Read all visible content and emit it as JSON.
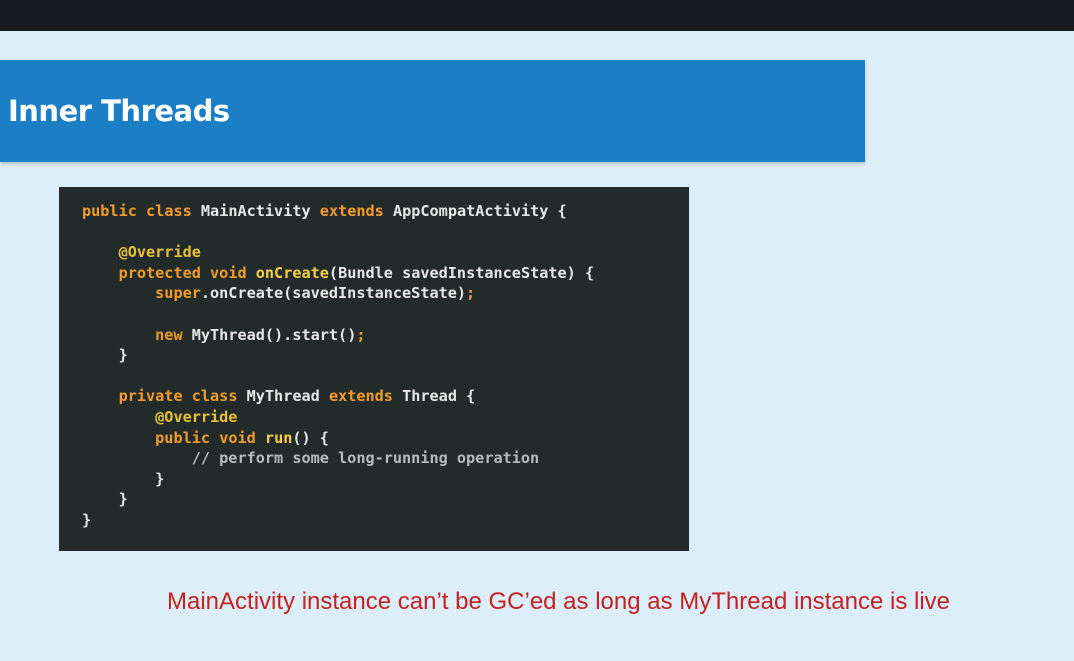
{
  "slide": {
    "title": "Inner Threads",
    "caption": "MainActivity instance can’t be GC’ed as long as MyThread instance is live"
  },
  "code": {
    "language": "java",
    "tokens": {
      "l1_kw1": "public",
      "l1_kw2": "class",
      "l1_name": "MainActivity",
      "l1_kw3": "extends",
      "l1_rest": "AppCompatActivity {",
      "l3_ann": "@Override",
      "l4_kw1": "protected",
      "l4_kw2": "void",
      "l4_fn": "onCreate",
      "l4_rest": "(Bundle savedInstanceState) {",
      "l5_kw": "super",
      "l5_rest": ".onCreate(savedInstanceState)",
      "l5_semi": ";",
      "l7_kw": "new",
      "l7_rest": "MyThread().start()",
      "l7_semi": ";",
      "l8_brace": "}",
      "l10_kw1": "private",
      "l10_kw2": "class",
      "l10_name": "MyThread",
      "l10_kw3": "extends",
      "l10_rest": "Thread {",
      "l11_ann": "@Override",
      "l12_kw1": "public",
      "l12_kw2": "void",
      "l12_fn": "run",
      "l12_rest": "() {",
      "l13_cm": "// perform some long-running operation",
      "l14_brace": "}",
      "l15_brace": "}",
      "l16_brace": "}"
    }
  },
  "colors": {
    "top_bar": "#151a21",
    "background": "#ddeefb",
    "banner": "#1c7ec4",
    "code_bg": "#222b2a",
    "keyword": "#f49c2b",
    "annotation": "#e6c238",
    "caption": "#c62020"
  }
}
